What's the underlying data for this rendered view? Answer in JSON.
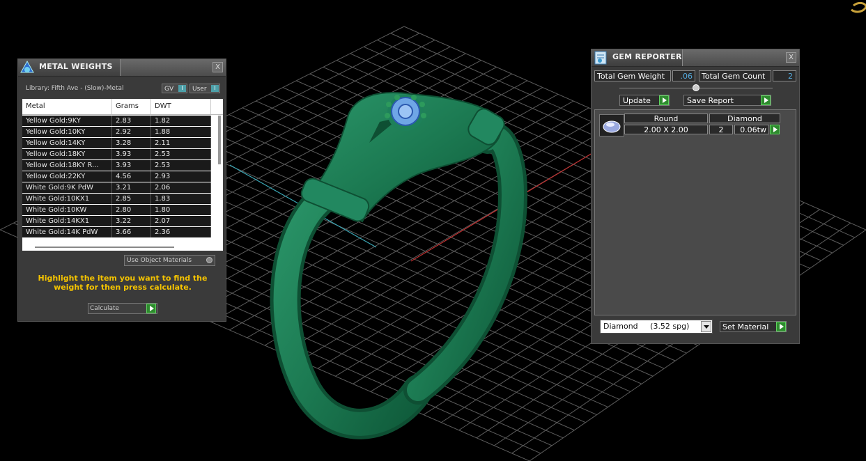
{
  "metal_weights": {
    "title": "METAL WEIGHTS",
    "library": "Library: Fifth Ave - (Slow)-Metal",
    "gv_label": "GV",
    "user_label": "User",
    "toggle_mark": "I",
    "columns": [
      "Metal",
      "Grams",
      "DWT"
    ],
    "rows": [
      [
        "Yellow Gold:9KY",
        "2.83",
        "1.82"
      ],
      [
        "Yellow Gold:10KY",
        "2.92",
        "1.88"
      ],
      [
        "Yellow Gold:14KY",
        "3.28",
        "2.11"
      ],
      [
        "Yellow Gold:18KY",
        "3.93",
        "2.53"
      ],
      [
        "Yellow Gold:18KY R...",
        "3.93",
        "2.53"
      ],
      [
        "Yellow Gold:22KY",
        "4.56",
        "2.93"
      ],
      [
        "White Gold:9K PdW",
        "3.21",
        "2.06"
      ],
      [
        "White Gold:10KX1",
        "2.85",
        "1.83"
      ],
      [
        "White Gold:10KW",
        "2.80",
        "1.80"
      ],
      [
        "White Gold:14KX1",
        "3.22",
        "2.07"
      ],
      [
        "White Gold:14K PdW",
        "3.66",
        "2.36"
      ]
    ],
    "use_object_materials": "Use Object Materials",
    "hint": "Highlight the item you want to find the weight for then press calculate.",
    "calculate": "Calculate",
    "close": "X"
  },
  "gem_reporter": {
    "title": "GEM REPORTER",
    "total_gem_weight_label": "Total Gem Weight",
    "total_gem_weight": ".06",
    "total_gem_count_label": "Total Gem Count",
    "total_gem_count": "2",
    "update": "Update",
    "save_report": "Save Report",
    "gem": {
      "shape": "Round",
      "material": "Diamond",
      "size": "2.00 X 2.00",
      "count": "2",
      "weight": "0.06tw"
    },
    "material_select": "Diamond     (3.52 spg)",
    "set_material": "Set Material",
    "close": "X"
  },
  "colors": {
    "ring_green": "#1c7a52",
    "hint_yellow": "#f5c400",
    "accent_green": "#2e8b2e",
    "value_cyan": "#55aadd"
  }
}
